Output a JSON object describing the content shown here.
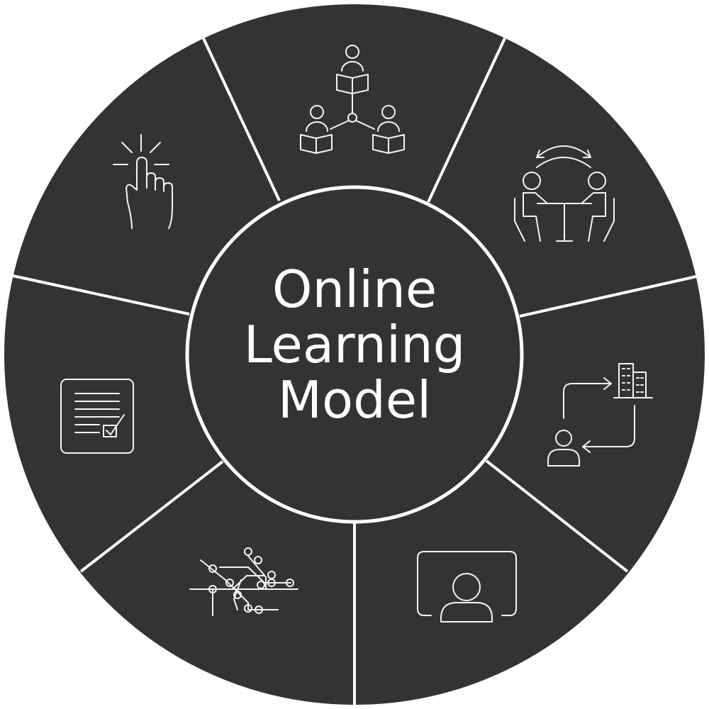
{
  "diagram": {
    "title_lines": [
      "Online",
      "Learning",
      "Model"
    ],
    "segments": [
      {
        "icon": "group-reading-network-icon"
      },
      {
        "icon": "discussion-meeting-icon"
      },
      {
        "icon": "person-to-organization-icon"
      },
      {
        "icon": "video-presenter-icon"
      },
      {
        "icon": "learning-path-map-icon"
      },
      {
        "icon": "checklist-document-icon"
      },
      {
        "icon": "touch-click-icon"
      }
    ]
  },
  "colors": {
    "wheel": "#333333",
    "lines": "#ffffff",
    "icons": "#f4f4f4"
  }
}
